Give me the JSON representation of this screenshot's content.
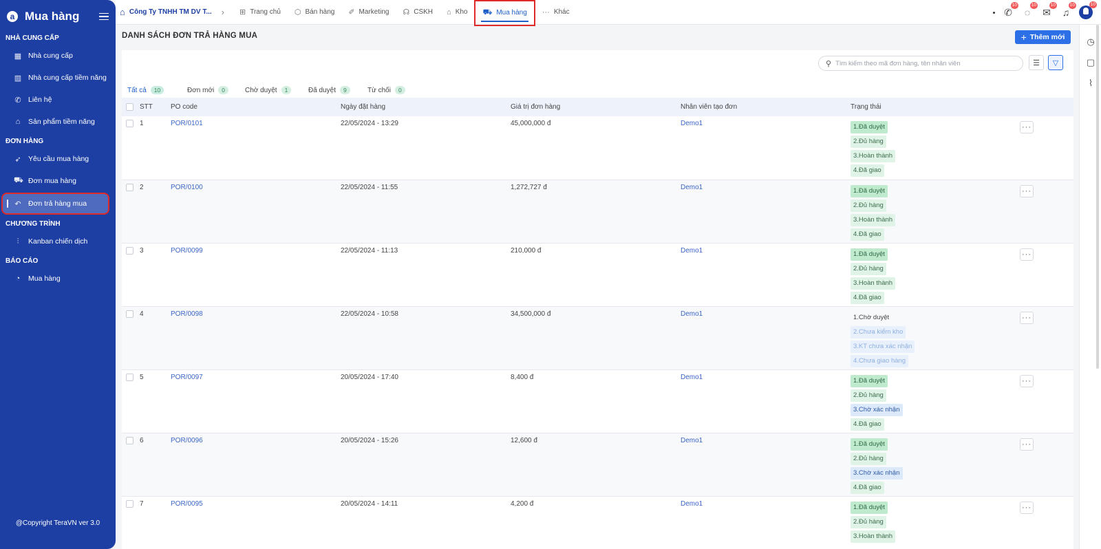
{
  "sidebar": {
    "logo": "a",
    "title": "Mua hàng",
    "copyright": "@Copyright TeraVN ver 3.0",
    "sections": [
      {
        "title": "NHÀ CUNG CẤP",
        "items": [
          {
            "label": "Nhà cung cấp",
            "icon": "building-icon",
            "glyph": "▦"
          },
          {
            "label": "Nhà cung cấp tiềm năng",
            "icon": "building-chart-icon",
            "glyph": "▥"
          },
          {
            "label": "Liên hệ",
            "icon": "phone-icon",
            "glyph": "✆"
          },
          {
            "label": "Sản phẩm tiềm năng",
            "icon": "product-icon",
            "glyph": "⌂"
          }
        ]
      },
      {
        "title": "ĐƠN HÀNG",
        "items": [
          {
            "label": "Yêu cầu mua hàng",
            "icon": "rocket-icon",
            "glyph": "➶"
          },
          {
            "label": "Đơn mua hàng",
            "icon": "cart-icon",
            "glyph": "⛟"
          },
          {
            "label": "Đơn trả hàng mua",
            "icon": "return-icon",
            "glyph": "↶",
            "active": true
          }
        ]
      },
      {
        "title": "CHƯƠNG TRÌNH",
        "items": [
          {
            "label": "Kanban chiến dịch",
            "icon": "kanban-icon",
            "glyph": "⫶"
          }
        ]
      },
      {
        "title": "BÁO CÁO",
        "items": [
          {
            "label": "Mua hàng",
            "icon": "report-chart-icon",
            "glyph": "◔"
          }
        ]
      }
    ]
  },
  "topbar": {
    "company": "Công Ty TNHH TM DV T...",
    "nav": [
      {
        "label": "Trang chủ",
        "icon": "home-grid-icon",
        "glyph": "⊞"
      },
      {
        "label": "Bán hàng",
        "icon": "box-icon",
        "glyph": "⬡"
      },
      {
        "label": "Marketing",
        "icon": "marketing-icon",
        "glyph": "✐"
      },
      {
        "label": "CSKH",
        "icon": "support-icon",
        "glyph": "☊"
      },
      {
        "label": "Kho",
        "icon": "warehouse-icon",
        "glyph": "⌂"
      },
      {
        "label": "Mua hàng",
        "icon": "cart-icon",
        "glyph": "⛟",
        "active": true
      },
      {
        "label": "Khác",
        "icon": "more-icon",
        "glyph": "···"
      }
    ],
    "badges": {
      "phone": "10",
      "chat": "10",
      "mail": "10",
      "bell": "10",
      "avatar": "10"
    }
  },
  "page": {
    "title": "DANH SÁCH ĐƠN TRẢ HÀNG MUA",
    "add_label": "Thêm mới",
    "search_placeholder": "Tìm kiếm theo mã đơn hàng, tên nhân viên"
  },
  "tabs": [
    {
      "label": "Tất cả",
      "count": "10",
      "active": true
    },
    {
      "label": "Đơn mới",
      "count": "0"
    },
    {
      "label": "Chờ duyệt",
      "count": "1"
    },
    {
      "label": "Đã duyệt",
      "count": "9"
    },
    {
      "label": "Từ chối",
      "count": "0"
    }
  ],
  "table": {
    "headers": {
      "stt": "STT",
      "code": "PO code",
      "date": "Ngày đặt hàng",
      "value": "Giá trị đơn hàng",
      "staff": "Nhân viên tạo đơn",
      "status": "Trạng thái"
    },
    "rows": [
      {
        "stt": "1",
        "code": "POR/0101",
        "date": "22/05/2024 - 13:29",
        "value": "45,000,000 đ",
        "staff": "Demo1",
        "status": [
          [
            "1.Đã duyệt",
            "green"
          ],
          [
            "2.Đủ hàng",
            "lgreen"
          ],
          [
            "3.Hoàn thành",
            "lgreen"
          ],
          [
            "4.Đã giao",
            "lgreen"
          ]
        ]
      },
      {
        "stt": "2",
        "code": "POR/0100",
        "date": "22/05/2024 - 11:55",
        "value": "1,272,727 đ",
        "staff": "Demo1",
        "status": [
          [
            "1.Đã duyệt",
            "green"
          ],
          [
            "2.Đủ hàng",
            "lgreen"
          ],
          [
            "3.Hoàn thành",
            "lgreen"
          ],
          [
            "4.Đã giao",
            "lgreen"
          ]
        ]
      },
      {
        "stt": "3",
        "code": "POR/0099",
        "date": "22/05/2024 - 11:13",
        "value": "210,000 đ",
        "staff": "Demo1",
        "status": [
          [
            "1.Đã duyệt",
            "green"
          ],
          [
            "2.Đủ hàng",
            "lgreen"
          ],
          [
            "3.Hoàn thành",
            "lgreen"
          ],
          [
            "4.Đã giao",
            "lgreen"
          ]
        ]
      },
      {
        "stt": "4",
        "code": "POR/0098",
        "date": "22/05/2024 - 10:58",
        "value": "34,500,000 đ",
        "staff": "Demo1",
        "status": [
          [
            "1.Chờ duyệt",
            "plain"
          ],
          [
            "2.Chưa kiểm kho",
            "faded"
          ],
          [
            "3.KT chưa xác nhận",
            "faded"
          ],
          [
            "4.Chưa giao hàng",
            "faded"
          ]
        ]
      },
      {
        "stt": "5",
        "code": "POR/0097",
        "date": "20/05/2024 - 17:40",
        "value": "8,400 đ",
        "staff": "Demo1",
        "status": [
          [
            "1.Đã duyệt",
            "green"
          ],
          [
            "2.Đủ hàng",
            "lgreen"
          ],
          [
            "3.Chờ xác nhận",
            "blue"
          ],
          [
            "4.Đã giao",
            "lgreen"
          ]
        ]
      },
      {
        "stt": "6",
        "code": "POR/0096",
        "date": "20/05/2024 - 15:26",
        "value": "12,600 đ",
        "staff": "Demo1",
        "status": [
          [
            "1.Đã duyệt",
            "green"
          ],
          [
            "2.Đủ hàng",
            "lgreen"
          ],
          [
            "3.Chờ xác nhận",
            "blue"
          ],
          [
            "4.Đã giao",
            "lgreen"
          ]
        ]
      },
      {
        "stt": "7",
        "code": "POR/0095",
        "date": "20/05/2024 - 14:11",
        "value": "4,200 đ",
        "staff": "Demo1",
        "status": [
          [
            "1.Đã duyệt",
            "green"
          ],
          [
            "2.Đủ hàng",
            "lgreen"
          ],
          [
            "3.Hoàn thành",
            "lgreen"
          ]
        ]
      }
    ]
  },
  "colors": {
    "sidebar": "#1d3fa4",
    "accent": "#2c6fe6",
    "highlight": "#e02a2a"
  }
}
